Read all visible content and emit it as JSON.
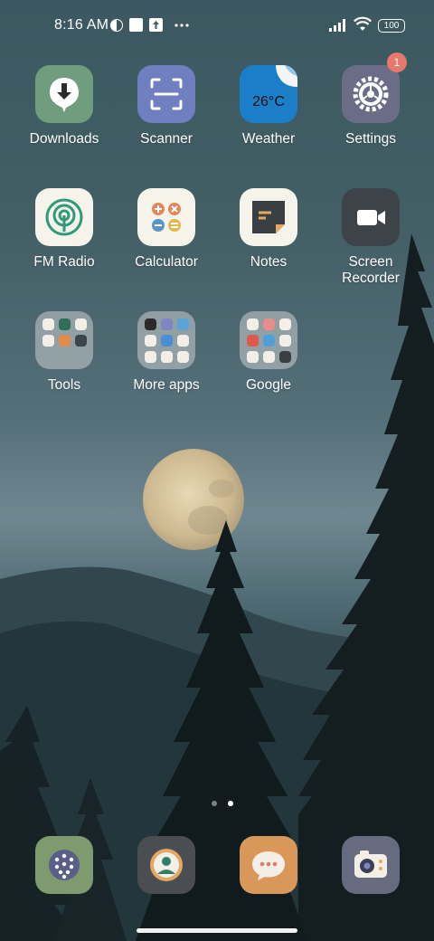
{
  "status_bar": {
    "time": "8:16 AM",
    "battery": "100",
    "left_icons": [
      "vpn-icon",
      "square-notification-icon",
      "upload-notification-icon",
      "more-notifications-icon"
    ],
    "right_icons": [
      "signal-icon",
      "wifi-icon",
      "battery-icon"
    ]
  },
  "apps": [
    {
      "label": "Downloads",
      "icon": "download-icon",
      "color": "#6f9d7e"
    },
    {
      "label": "Scanner",
      "icon": "scan-icon",
      "color": "#6f7fbf"
    },
    {
      "label": "Weather",
      "icon": "weather-icon",
      "color": "#1a7fc8",
      "text": "26°C"
    },
    {
      "label": "Settings",
      "icon": "gear-icon",
      "color": "#6b6d86",
      "badge": "1"
    },
    {
      "label": "FM Radio",
      "icon": "radio-icon",
      "color": "#f5f3ea"
    },
    {
      "label": "Calculator",
      "icon": "calculator-icon",
      "color": "#f5f3ea"
    },
    {
      "label": "Notes",
      "icon": "notes-icon",
      "color": "#f5f3ea"
    },
    {
      "label": "Screen Recorder",
      "icon": "video-camera-icon",
      "color": "#3c4449"
    },
    {
      "label": "Tools",
      "icon": "folder-icon"
    },
    {
      "label": "More apps",
      "icon": "folder-icon"
    },
    {
      "label": "Google",
      "icon": "folder-icon"
    }
  ],
  "pager": {
    "pages": 2,
    "current": 2
  },
  "dock": [
    {
      "name": "dialer",
      "icon": "dialpad-icon",
      "color": "#7e9a6e"
    },
    {
      "name": "contacts",
      "icon": "contacts-icon",
      "color": "#4a4d52"
    },
    {
      "name": "messages",
      "icon": "message-icon",
      "color": "#d9975a"
    },
    {
      "name": "camera",
      "icon": "camera-icon",
      "color": "#666b80"
    }
  ]
}
